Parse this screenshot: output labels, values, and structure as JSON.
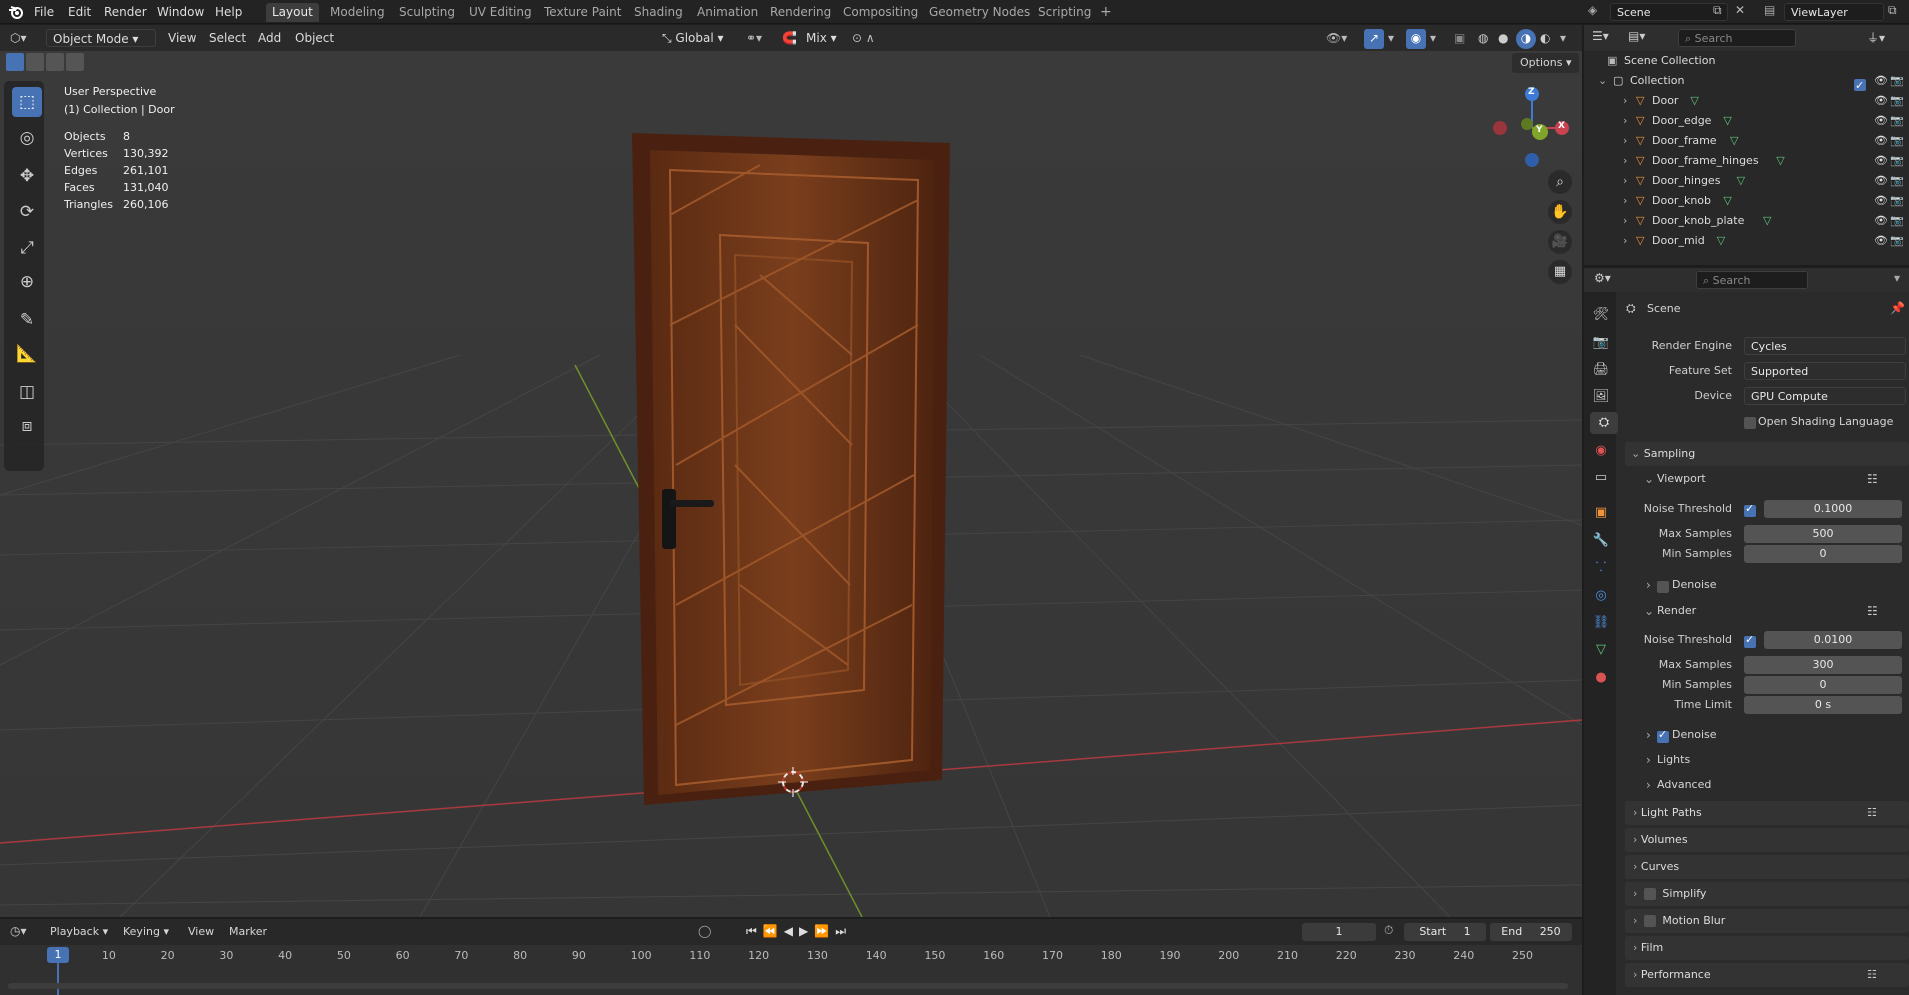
{
  "menubar": {
    "items": [
      "File",
      "Edit",
      "Render",
      "Window",
      "Help"
    ]
  },
  "workspaces": [
    "Layout",
    "Modeling",
    "Sculpting",
    "UV Editing",
    "Texture Paint",
    "Shading",
    "Animation",
    "Rendering",
    "Compositing",
    "Geometry Nodes",
    "Scripting"
  ],
  "active_workspace": "Layout",
  "scene_field": "Scene",
  "viewlayer_field": "ViewLayer",
  "viewport_header": {
    "mode": "Object Mode",
    "view": "View",
    "select": "Select",
    "add": "Add",
    "object": "Object",
    "orientation": "Global",
    "snap": "Mix",
    "options": "Options"
  },
  "overlay": {
    "perspective": "User Perspective",
    "collection": "(1) Collection | Door",
    "stats": [
      {
        "label": "Objects",
        "value": "8"
      },
      {
        "label": "Vertices",
        "value": "130,392"
      },
      {
        "label": "Edges",
        "value": "261,101"
      },
      {
        "label": "Faces",
        "value": "131,040"
      },
      {
        "label": "Triangles",
        "value": "260,106"
      }
    ]
  },
  "gizmo": {
    "x": "X",
    "y": "Y",
    "z": "Z"
  },
  "outliner": {
    "search_placeholder": "Search",
    "scene_collection": "Scene Collection",
    "collection": "Collection",
    "objects": [
      "Door",
      "Door_edge",
      "Door_frame",
      "Door_frame_hinges",
      "Door_hinges",
      "Door_knob",
      "Door_knob_plate",
      "Door_mid"
    ]
  },
  "properties": {
    "search_placeholder": "Search",
    "context": "Scene",
    "render_engine_label": "Render Engine",
    "render_engine": "Cycles",
    "feature_set_label": "Feature Set",
    "feature_set": "Supported",
    "device_label": "Device",
    "device": "GPU Compute",
    "osl_label": "Open Shading Language",
    "sampling": "Sampling",
    "viewport": "Viewport",
    "noise_threshold_label": "Noise Threshold",
    "viewport_noise_threshold": "0.1000",
    "max_samples_label": "Max Samples",
    "viewport_max_samples": "500",
    "min_samples_label": "Min Samples",
    "viewport_min_samples": "0",
    "denoise_label": "Denoise",
    "render": "Render",
    "render_noise_threshold": "0.0100",
    "render_max_samples": "300",
    "render_min_samples": "0",
    "time_limit_label": "Time Limit",
    "time_limit": "0 s",
    "lights": "Lights",
    "advanced": "Advanced",
    "light_paths": "Light Paths",
    "volumes": "Volumes",
    "curves": "Curves",
    "simplify": "Simplify",
    "motion_blur": "Motion Blur",
    "film": "Film",
    "performance": "Performance"
  },
  "timeline": {
    "playback": "Playback",
    "keying": "Keying",
    "view": "View",
    "marker": "Marker",
    "current_frame": "1",
    "start_label": "Start",
    "start": "1",
    "end_label": "End",
    "end": "250",
    "ruler": [
      "1",
      "10",
      "20",
      "30",
      "40",
      "50",
      "60",
      "70",
      "80",
      "90",
      "100",
      "110",
      "120",
      "130",
      "140",
      "150",
      "160",
      "170",
      "180",
      "190",
      "200",
      "210",
      "220",
      "230",
      "240",
      "250"
    ]
  },
  "colors": {
    "accent": "#4772b3",
    "x_axis": "#c8434f",
    "y_axis": "#7fa52a",
    "z_axis": "#3d7bd6",
    "door_wood": "#6b3517"
  }
}
